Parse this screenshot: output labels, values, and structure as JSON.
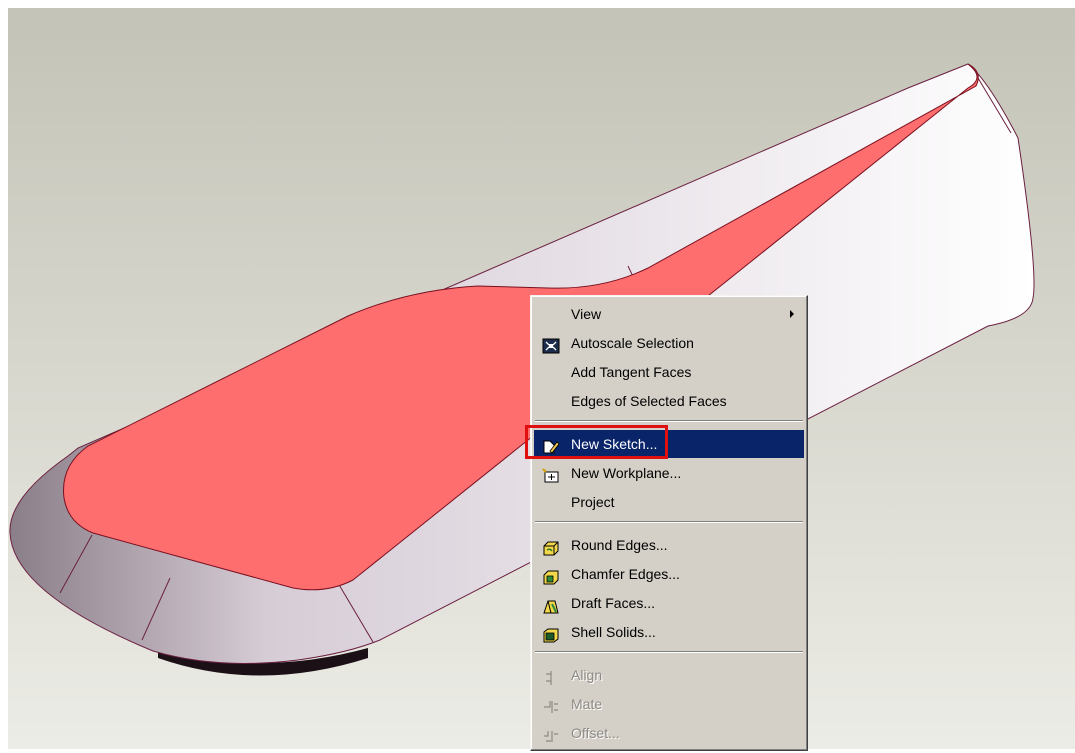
{
  "context_menu": {
    "items": [
      {
        "label": "View",
        "icon": "none",
        "submenu": true
      },
      {
        "label": "Autoscale Selection",
        "icon": "autoscale-icon"
      },
      {
        "label": "Add Tangent Faces",
        "icon": "none"
      },
      {
        "label": "Edges of Selected Faces",
        "icon": "none"
      },
      {
        "label": "New Sketch...",
        "icon": "sketch-pencil-icon",
        "active": true
      },
      {
        "label": "New Workplane...",
        "icon": "workplane-icon"
      },
      {
        "label": "Project",
        "icon": "none"
      },
      {
        "label": "Round Edges...",
        "icon": "round-edges-icon"
      },
      {
        "label": "Chamfer Edges...",
        "icon": "chamfer-edges-icon"
      },
      {
        "label": "Draft Faces...",
        "icon": "draft-faces-icon"
      },
      {
        "label": "Shell Solids...",
        "icon": "shell-solids-icon"
      },
      {
        "label": "Align",
        "icon": "align-icon",
        "disabled": true
      },
      {
        "label": "Mate",
        "icon": "mate-icon",
        "disabled": true
      },
      {
        "label": "Offset...",
        "icon": "offset-icon",
        "disabled": true
      }
    ]
  },
  "colors": {
    "selected_face": "#ff6e6e",
    "menu_background": "#d4d0c8",
    "menu_highlight": "#0a246a",
    "annotation_box": "#e01010"
  }
}
